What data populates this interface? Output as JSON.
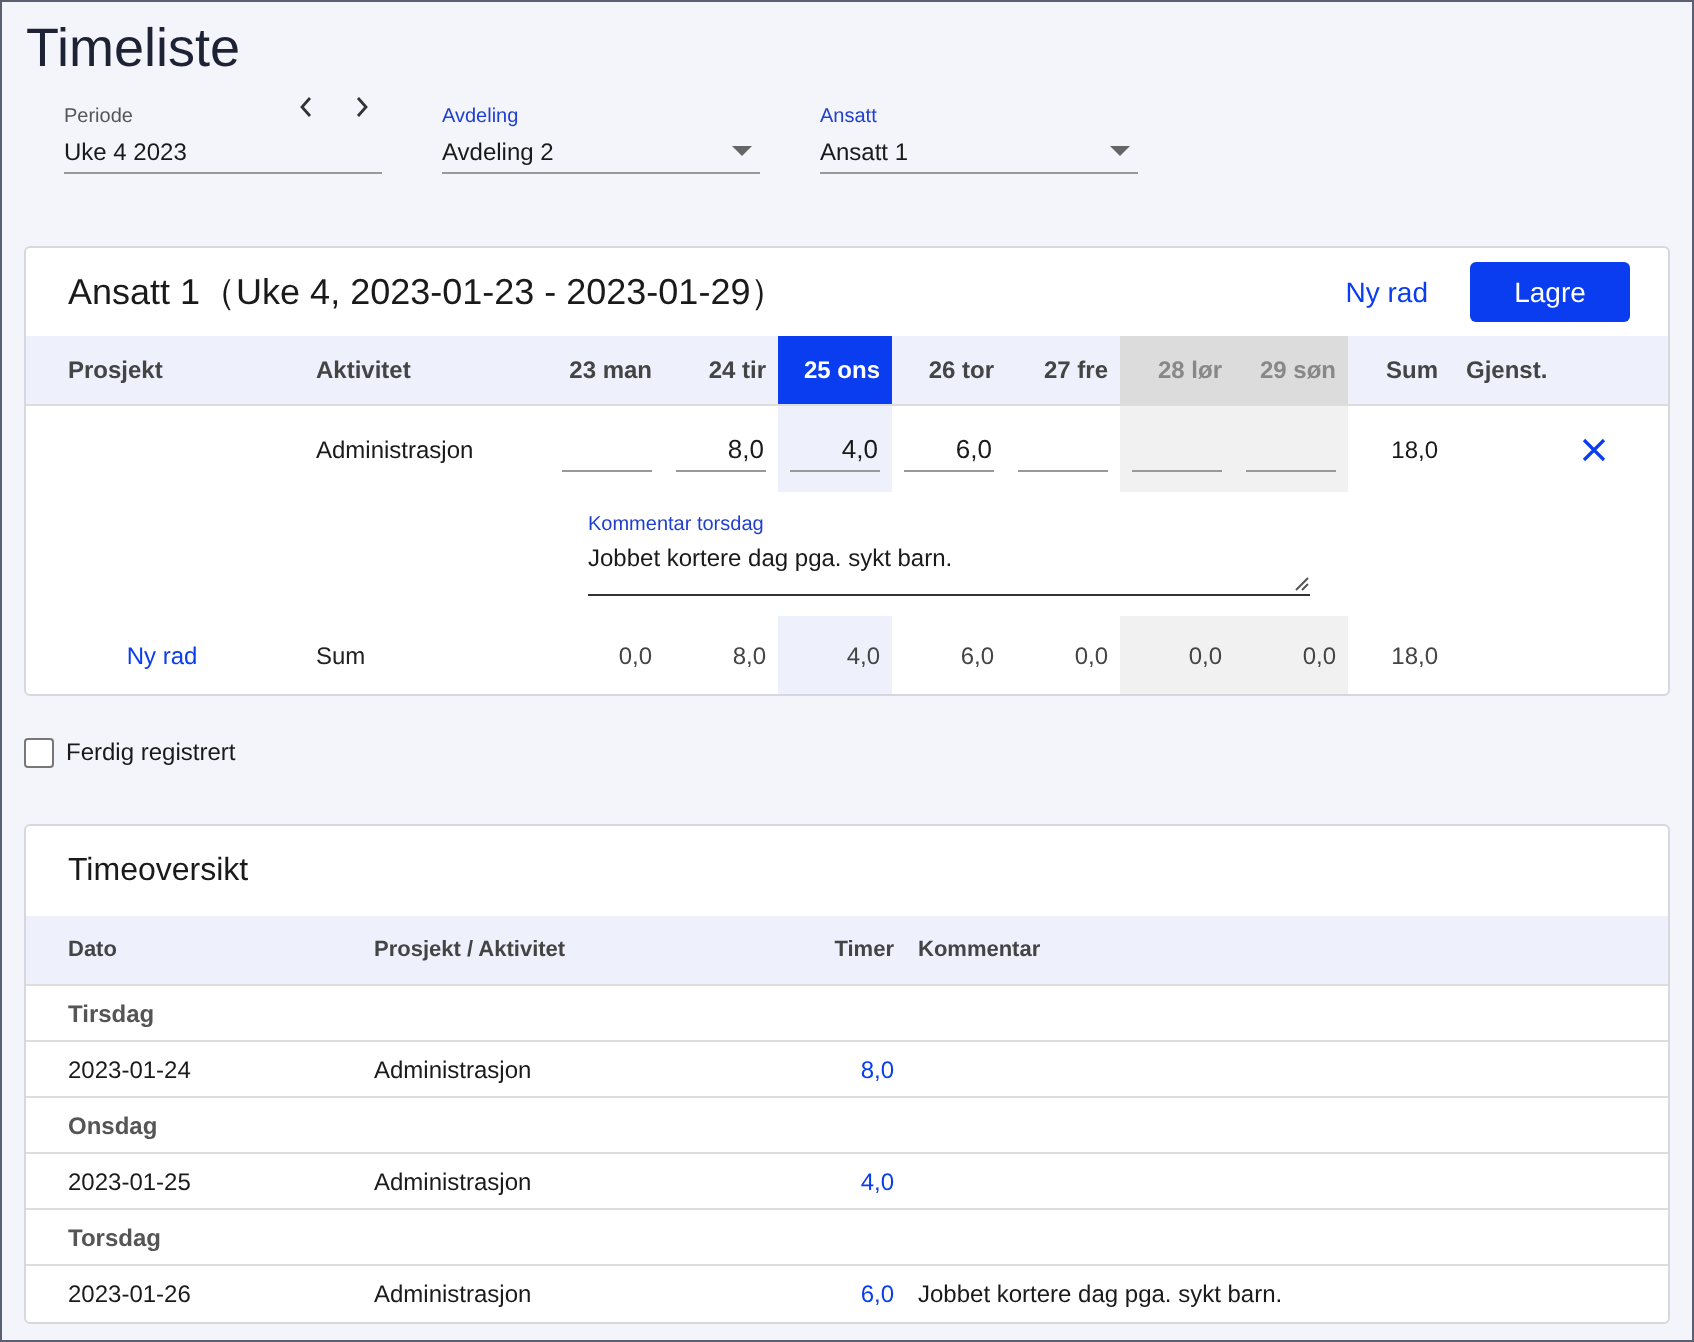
{
  "title": "Timeliste",
  "filters": [
    {
      "label": "Periode",
      "value": "Uke 4 2023",
      "kind": "period",
      "focused": false
    },
    {
      "label": "Avdeling",
      "value": "Avdeling 2",
      "kind": "dropdown",
      "focused": true
    },
    {
      "label": "Ansatt",
      "value": "Ansatt 1",
      "kind": "dropdown",
      "focused": true
    }
  ],
  "week_card": {
    "title": "Ansatt 1（Uke 4, 2023-01-23 - 2023-01-29）",
    "new_row_link": "Ny rad",
    "save_button": "Lagre",
    "columns": {
      "project": "Prosjekt",
      "activity": "Aktivitet",
      "sum": "Sum",
      "remaining": "Gjenst."
    },
    "days": [
      {
        "label": "23 man",
        "weekend": false,
        "selected": false
      },
      {
        "label": "24 tir",
        "weekend": false,
        "selected": false
      },
      {
        "label": "25 ons",
        "weekend": false,
        "selected": true
      },
      {
        "label": "26 tor",
        "weekend": false,
        "selected": false
      },
      {
        "label": "27 fre",
        "weekend": false,
        "selected": false
      },
      {
        "label": "28 lør",
        "weekend": true,
        "selected": false
      },
      {
        "label": "29 søn",
        "weekend": true,
        "selected": false
      }
    ],
    "rows": [
      {
        "activity": "Administrasjon",
        "hours": [
          {
            "kind": "input"
          },
          {
            "kind": "input",
            "value": "8,0"
          },
          {
            "kind": "input",
            "value": "4,0"
          },
          {
            "kind": "input",
            "value": "6,0"
          },
          {
            "kind": "input"
          },
          {
            "kind": "input"
          },
          {
            "kind": "input"
          }
        ],
        "sum": "18,0"
      }
    ],
    "comment": {
      "label": "Kommentar torsdag",
      "value": "Jobbet kortere dag pga. sykt barn."
    },
    "sum_row": {
      "link": "Ny rad",
      "label": "Sum",
      "values": [
        "0,0",
        "8,0",
        "4,0",
        "6,0",
        "0,0",
        "0,0",
        "0,0"
      ],
      "total": "18,0"
    }
  },
  "done_checkbox": {
    "label": "Ferdig registrert",
    "checked": false
  },
  "overview": {
    "title": "Timeoversikt",
    "columns": [
      "Dato",
      "Prosjekt / Aktivitet",
      "Timer",
      "Kommentar"
    ],
    "rows": [
      {
        "kind": "group",
        "label": "Tirsdag"
      },
      {
        "kind": "entry",
        "date": "2023-01-24",
        "activity": "Administrasjon",
        "hours": "8,0"
      },
      {
        "kind": "group",
        "label": "Onsdag"
      },
      {
        "kind": "entry",
        "date": "2023-01-25",
        "activity": "Administrasjon",
        "hours": "4,0"
      },
      {
        "kind": "group",
        "label": "Torsdag"
      },
      {
        "kind": "entry",
        "date": "2023-01-26",
        "activity": "Administrasjon",
        "hours": "6,0",
        "comment": "Jobbet kortere dag pga. sykt barn."
      }
    ]
  }
}
